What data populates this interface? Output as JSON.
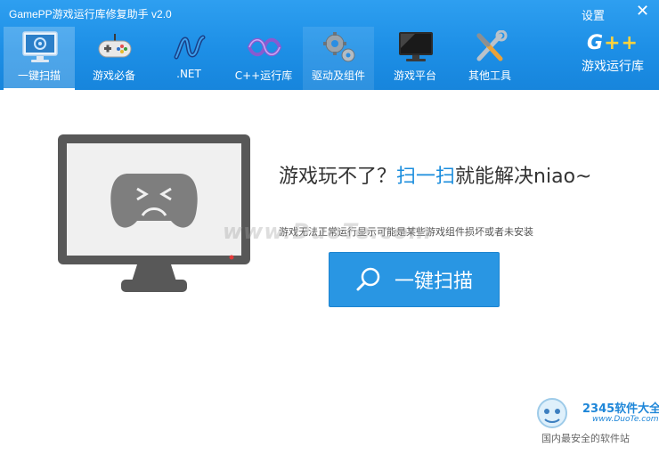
{
  "window": {
    "title": "GamePP游戏运行库修复助手 v2.0",
    "settings_label": "设置",
    "close_label": "✕"
  },
  "nav": {
    "items": [
      {
        "label": "一键扫描",
        "icon": "monitor-scan-icon",
        "active": true
      },
      {
        "label": "游戏必备",
        "icon": "gamepad-icon"
      },
      {
        "label": ".NET",
        "icon": "dotnet-icon"
      },
      {
        "label": "C++运行库",
        "icon": "visual-cpp-icon"
      },
      {
        "label": "驱动及组件",
        "icon": "gears-icon"
      },
      {
        "label": "游戏平台",
        "icon": "display-icon"
      },
      {
        "label": "其他工具",
        "icon": "tools-icon"
      }
    ],
    "brand_logo": "G++",
    "brand_sub": "游戏运行库"
  },
  "main": {
    "headline_part1": "游戏玩不了？",
    "headline_highlight": "扫一扫",
    "headline_part2": "就能解决niao~",
    "description": "游戏无法正常运行显示可能是某些游戏组件损坏或者未安装",
    "scan_button_label": "一键扫描"
  },
  "watermark": {
    "text": "www.DuoTe.com",
    "corner_brand": "2345软件大全",
    "corner_url": "www.DuoTe.com",
    "corner_tagline": "国内最安全的软件站"
  },
  "colors": {
    "header": "#1d8fe6",
    "accent": "#1a8ddd",
    "button": "#2996e3"
  }
}
